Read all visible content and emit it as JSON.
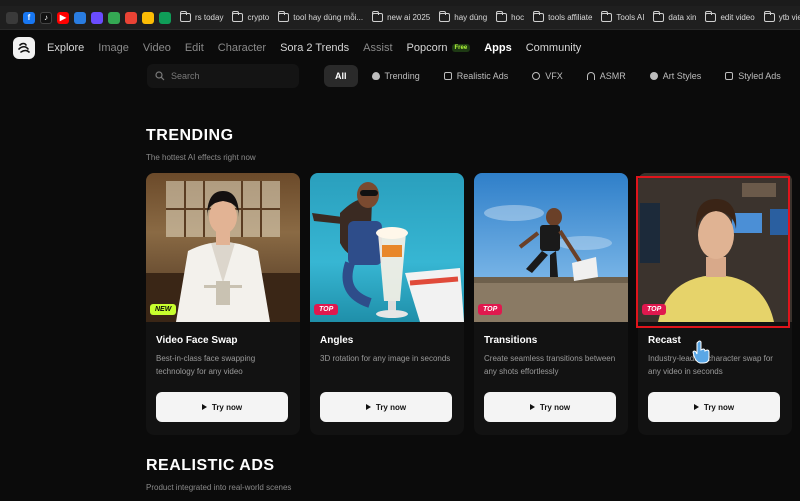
{
  "bookmarks": [
    {
      "label": "rs today"
    },
    {
      "label": "crypto"
    },
    {
      "label": "tool hay dùng mỗi..."
    },
    {
      "label": "new ai 2025"
    },
    {
      "label": "hay dùng"
    },
    {
      "label": "hoc"
    },
    {
      "label": "tools affiliate"
    },
    {
      "label": "Tools AI"
    },
    {
      "label": "data xin"
    },
    {
      "label": "edit video"
    },
    {
      "label": "ytb view"
    }
  ],
  "nav": {
    "items": [
      "Explore",
      "Image",
      "Video",
      "Edit",
      "Character",
      "Sora 2 Trends",
      "Assist",
      "Popcorn",
      "Apps",
      "Community"
    ],
    "free_badge": "Free"
  },
  "search": {
    "placeholder": "Search"
  },
  "filters": [
    "All",
    "Trending",
    "Realistic Ads",
    "VFX",
    "ASMR",
    "Art Styles",
    "Styled Ads"
  ],
  "trending": {
    "title": "TRENDING",
    "subtitle": "The hottest AI effects right now",
    "cards": [
      {
        "title": "Video Face Swap",
        "desc": "Best-in-class face swapping technology for any video",
        "badge": "NEW",
        "button": "Try now"
      },
      {
        "title": "Angles",
        "desc": "3D rotation for any image in seconds",
        "badge": "TOP",
        "button": "Try now"
      },
      {
        "title": "Transitions",
        "desc": "Create seamless transitions between any shots effortlessly",
        "badge": "TOP",
        "button": "Try now"
      },
      {
        "title": "Recast",
        "desc": "Industry-leading character swap for any video in seconds",
        "badge": "TOP",
        "button": "Try now"
      }
    ]
  },
  "realistic_ads": {
    "title": "REALISTIC ADS",
    "subtitle": "Product integrated into real-world scenes"
  },
  "colors": {
    "accent_new": "#c8ff2e",
    "accent_top": "#e0184e",
    "highlight": "#e0141b"
  }
}
